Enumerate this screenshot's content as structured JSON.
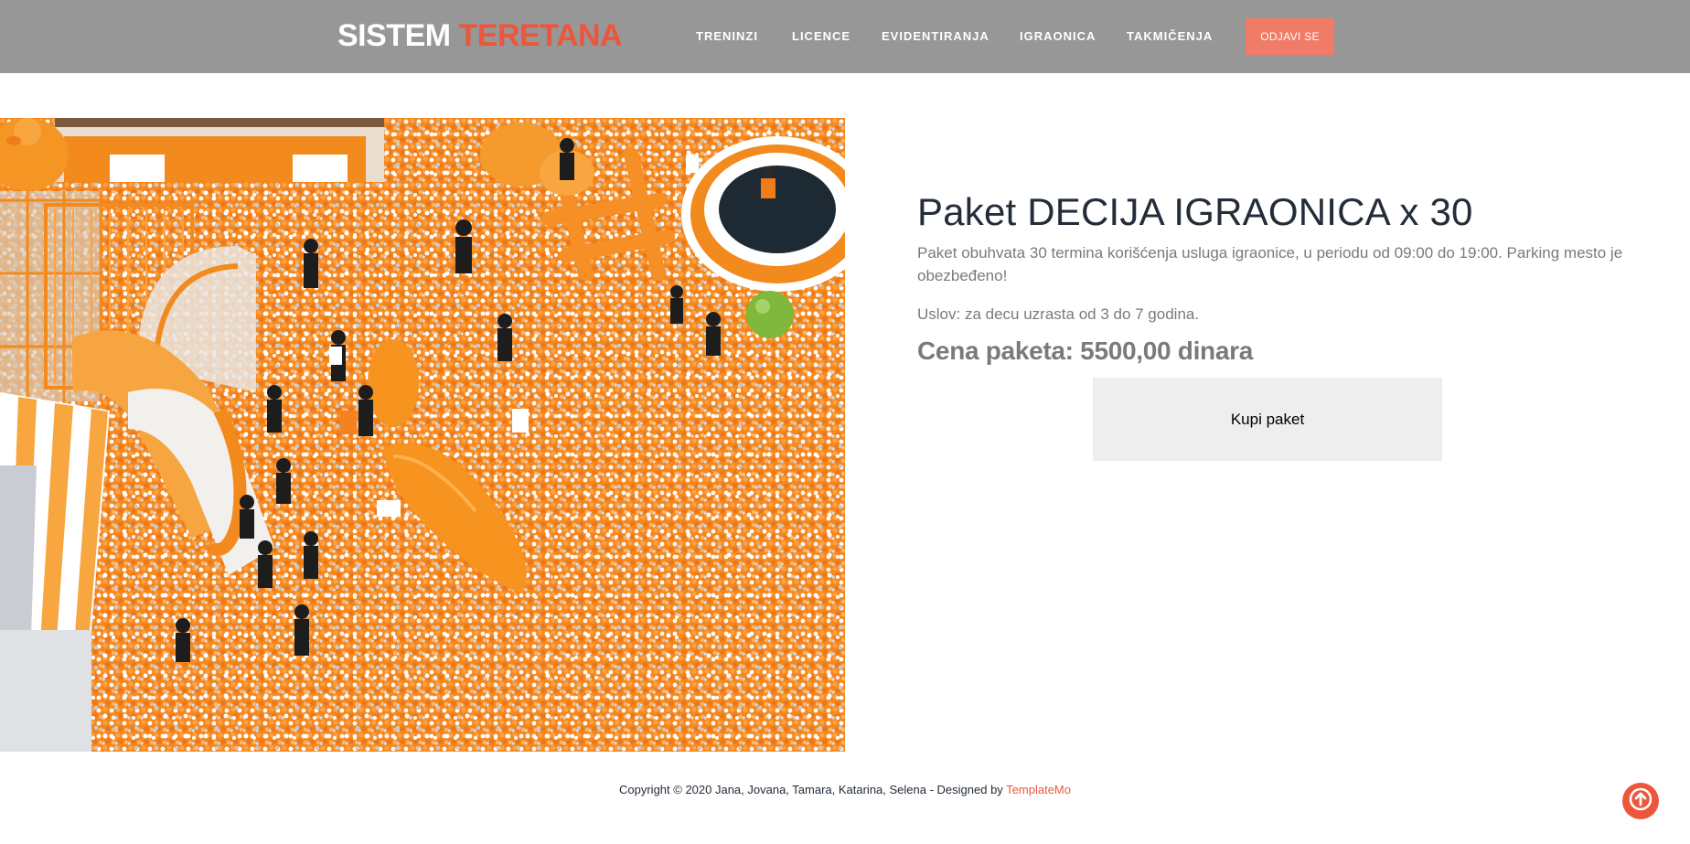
{
  "header": {
    "logo_part1": "SISTEM",
    "logo_part2": "TERETANA",
    "nav": [
      "TRENINZI",
      "LICENCE",
      "EVIDENTIRANJA",
      "IGRAONICA",
      "TAKMIČENJA"
    ],
    "logout_label": "ODJAVI SE"
  },
  "package": {
    "title": "Paket DECIJA IGRAONICA x 30",
    "description": "Paket obuhvata 30 termina korišćenja usluga igraonice, u periodu od 09:00 do 19:00. Parking mesto je obezbeđeno!",
    "condition": "Uslov: za decu uzrasta od 3 do 7 godina.",
    "price": "Cena paketa: 5500,00 dinara",
    "buy_label": "Kupi paket"
  },
  "footer": {
    "copyright": "Copyright © 2020 Jana, Jovana, Tamara, Katarina, Selena - Designed by ",
    "designer_link": "TemplateMo"
  },
  "colors": {
    "accent": "#ed563b",
    "header_bg": "#979797",
    "button_bg": "#eeeeee"
  },
  "icons": {
    "scroll_top": "arrow-up-icon"
  }
}
